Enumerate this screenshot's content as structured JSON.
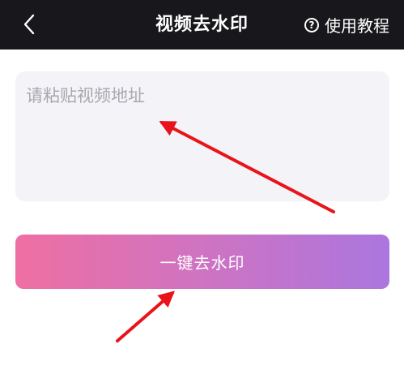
{
  "header": {
    "title": "视频去水印",
    "back_icon": "chevron-left-icon",
    "tutorial_label": "使用教程",
    "tutorial_icon": "question-circle-icon",
    "tutorial_icon_glyph": "?",
    "background": "#18181c"
  },
  "main": {
    "url_input": {
      "value": "",
      "placeholder": "请粘贴视频地址"
    },
    "remove_watermark_button": {
      "label": "一键去水印",
      "gradient_start": "#ef6fa2",
      "gradient_end": "#ab76df"
    }
  },
  "annotations": {
    "arrow_color": "#e8141a"
  }
}
